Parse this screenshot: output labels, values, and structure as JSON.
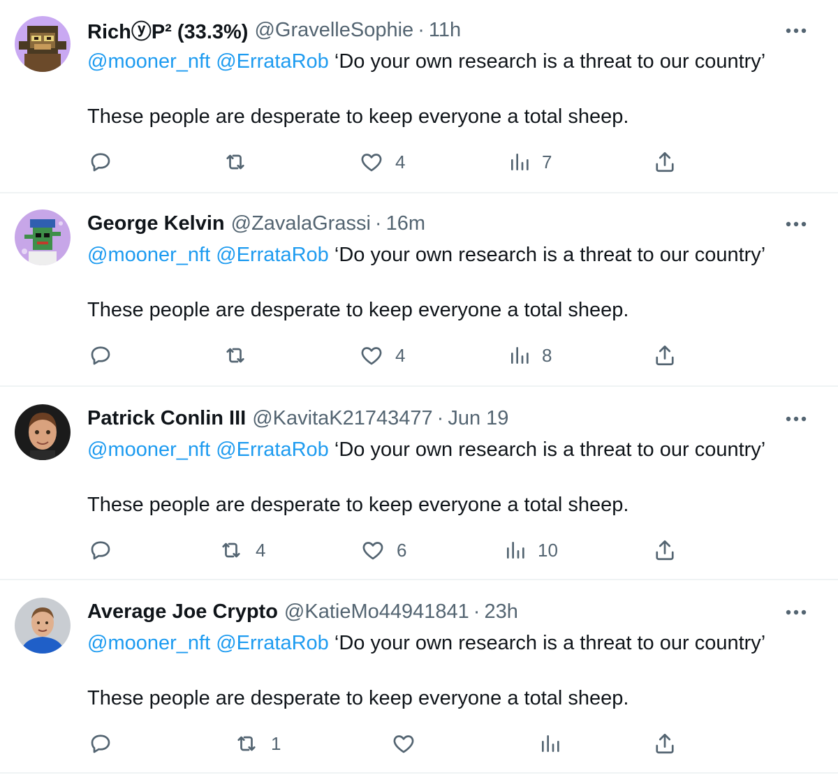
{
  "tweets": [
    {
      "name": "RichⓨP² (33.3%)",
      "handle": "@GravelleSophie",
      "separator": "·",
      "time": "11h",
      "mention1": "@mooner_nft",
      "mention2": "@ErrataRob",
      "quote": "‘Do your own research is a threat to our country’",
      "line2": "These people are desperate to keep everyone a total sheep.",
      "replies": "",
      "retweets": "",
      "likes": "4",
      "views": "7"
    },
    {
      "name": "George Kelvin",
      "handle": "@ZavalaGrassi",
      "separator": "·",
      "time": "16m",
      "mention1": "@mooner_nft",
      "mention2": "@ErrataRob",
      "quote": "‘Do your own research is a threat to our country’",
      "line2": "These people are desperate to keep everyone a total sheep.",
      "replies": "",
      "retweets": "",
      "likes": "4",
      "views": "8"
    },
    {
      "name": "Patrick Conlin III",
      "handle": "@KavitaK21743477",
      "separator": "·",
      "time": "Jun 19",
      "mention1": "@mooner_nft",
      "mention2": "@ErrataRob",
      "quote": "‘Do your own research is a threat to our country’",
      "line2": "These people are desperate to keep everyone a total sheep.",
      "replies": "",
      "retweets": "4",
      "likes": "6",
      "views": "10"
    },
    {
      "name": "Average Joe Crypto",
      "handle": "@KatieMo44941841",
      "separator": "·",
      "time": "23h",
      "mention1": "@mooner_nft",
      "mention2": "@ErrataRob",
      "quote": "‘Do your own research is a threat to our country’",
      "line2": "These people are desperate to keep everyone a total sheep.",
      "replies": "",
      "retweets": "1",
      "likes": "",
      "views": ""
    }
  ],
  "icons": {
    "more": "more-horizontal-icon",
    "reply": "reply-icon",
    "retweet": "retweet-icon",
    "like": "heart-icon",
    "views": "views-icon",
    "share": "share-icon"
  },
  "colors": {
    "text": "#0f1419",
    "secondary": "#536471",
    "link": "#1d9bf0",
    "divider": "#eff3f4"
  }
}
